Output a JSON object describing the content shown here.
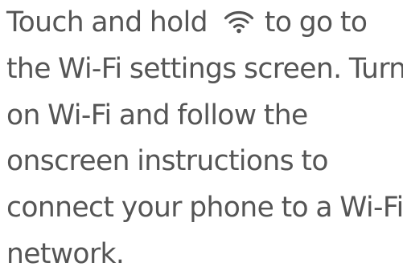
{
  "instruction": {
    "line_1_before_icon": "Touch and hold",
    "icon": "wifi-icon",
    "line_1_after_icon": "to go to",
    "line_2": "the Wi-Fi settings screen. Turn",
    "line_3": "on Wi-Fi and follow the",
    "line_4": "onscreen instructions to",
    "line_5": "connect your phone to a Wi-Fi",
    "line_6": "network."
  },
  "colors": {
    "text": "#555555",
    "icon": "#555555",
    "background": "#ffffff"
  }
}
